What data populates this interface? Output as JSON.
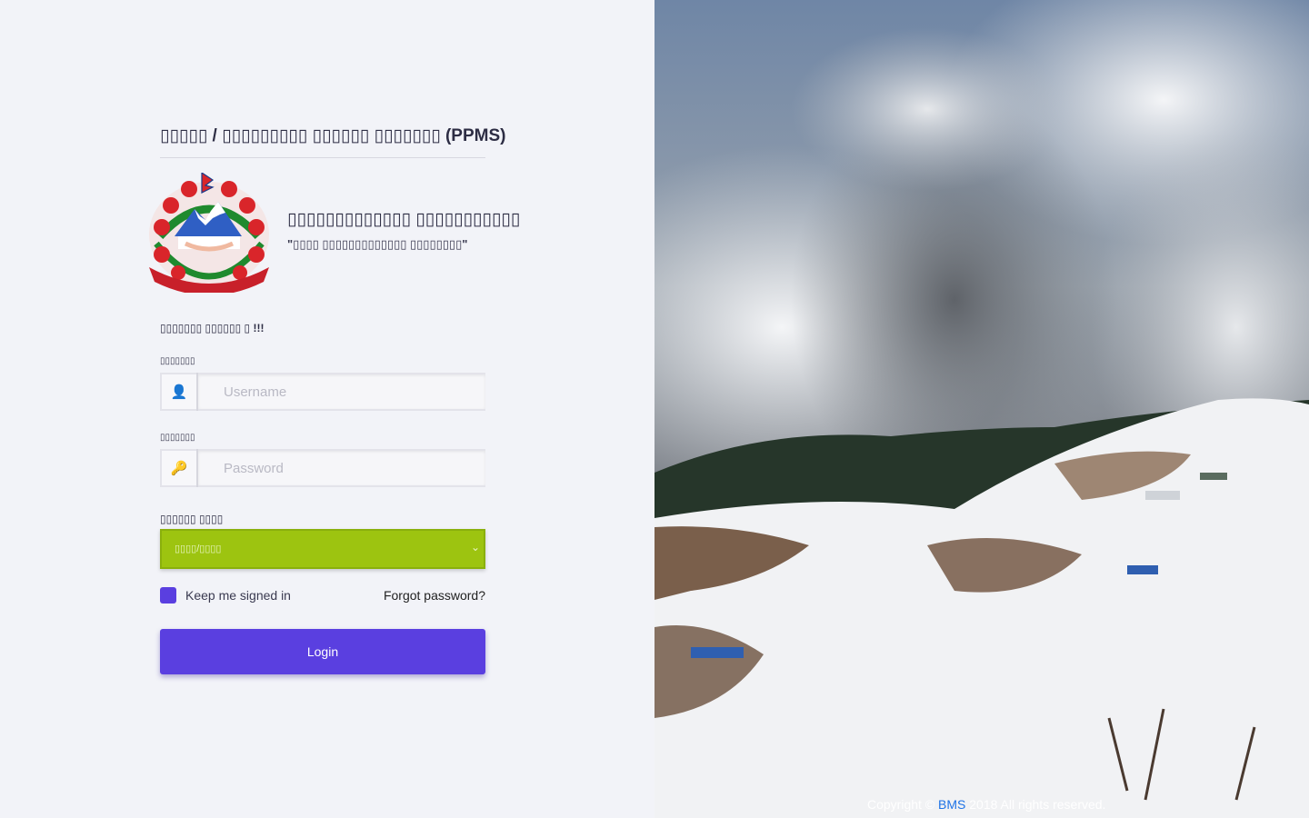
{
  "header": {
    "system_title": "▯▯▯▯▯ / ▯▯▯▯▯▯▯▯▯ ▯▯▯▯▯▯ ▯▯▯▯▯▯▯ (PPMS)"
  },
  "brand": {
    "name": "▯▯▯▯▯▯▯▯▯▯▯▯▯ ▯▯▯▯▯▯▯▯▯▯▯",
    "motto": "\"▯▯▯▯ ▯▯▯▯▯▯▯▯▯▯▯▯▯ ▯▯▯▯▯▯▯▯\"",
    "emblem_icon": "nepal-emblem-icon"
  },
  "login_form": {
    "welcome": "▯▯▯▯▯▯▯ ▯▯▯▯▯▯ ▯ !!!",
    "username_label": "▯▯▯▯▯▯▯",
    "username_placeholder": "Username",
    "username_value": "",
    "username_icon": "user-icon",
    "password_label": "▯▯▯▯▯▯▯",
    "password_placeholder": "Password",
    "password_value": "",
    "password_icon": "key-icon",
    "fiscal_year_label": "▯▯▯▯▯▯ ▯▯▯▯",
    "fiscal_year_selected": "▯▯▯▯/▯▯▯▯",
    "keep_signed_in": "Keep me signed in",
    "keep_signed_in_checked": true,
    "forgot_password": "Forgot password?",
    "login_button": "Login"
  },
  "footer": {
    "copyright_prefix": "Copyright ©",
    "brand": "BMS",
    "copyright_suffix": "2018 All rights reserved."
  },
  "colors": {
    "accent_purple": "#5a3fe0",
    "select_green": "#9dc410",
    "footer_link_blue": "#1f73e6",
    "background": "#f2f3f8"
  }
}
